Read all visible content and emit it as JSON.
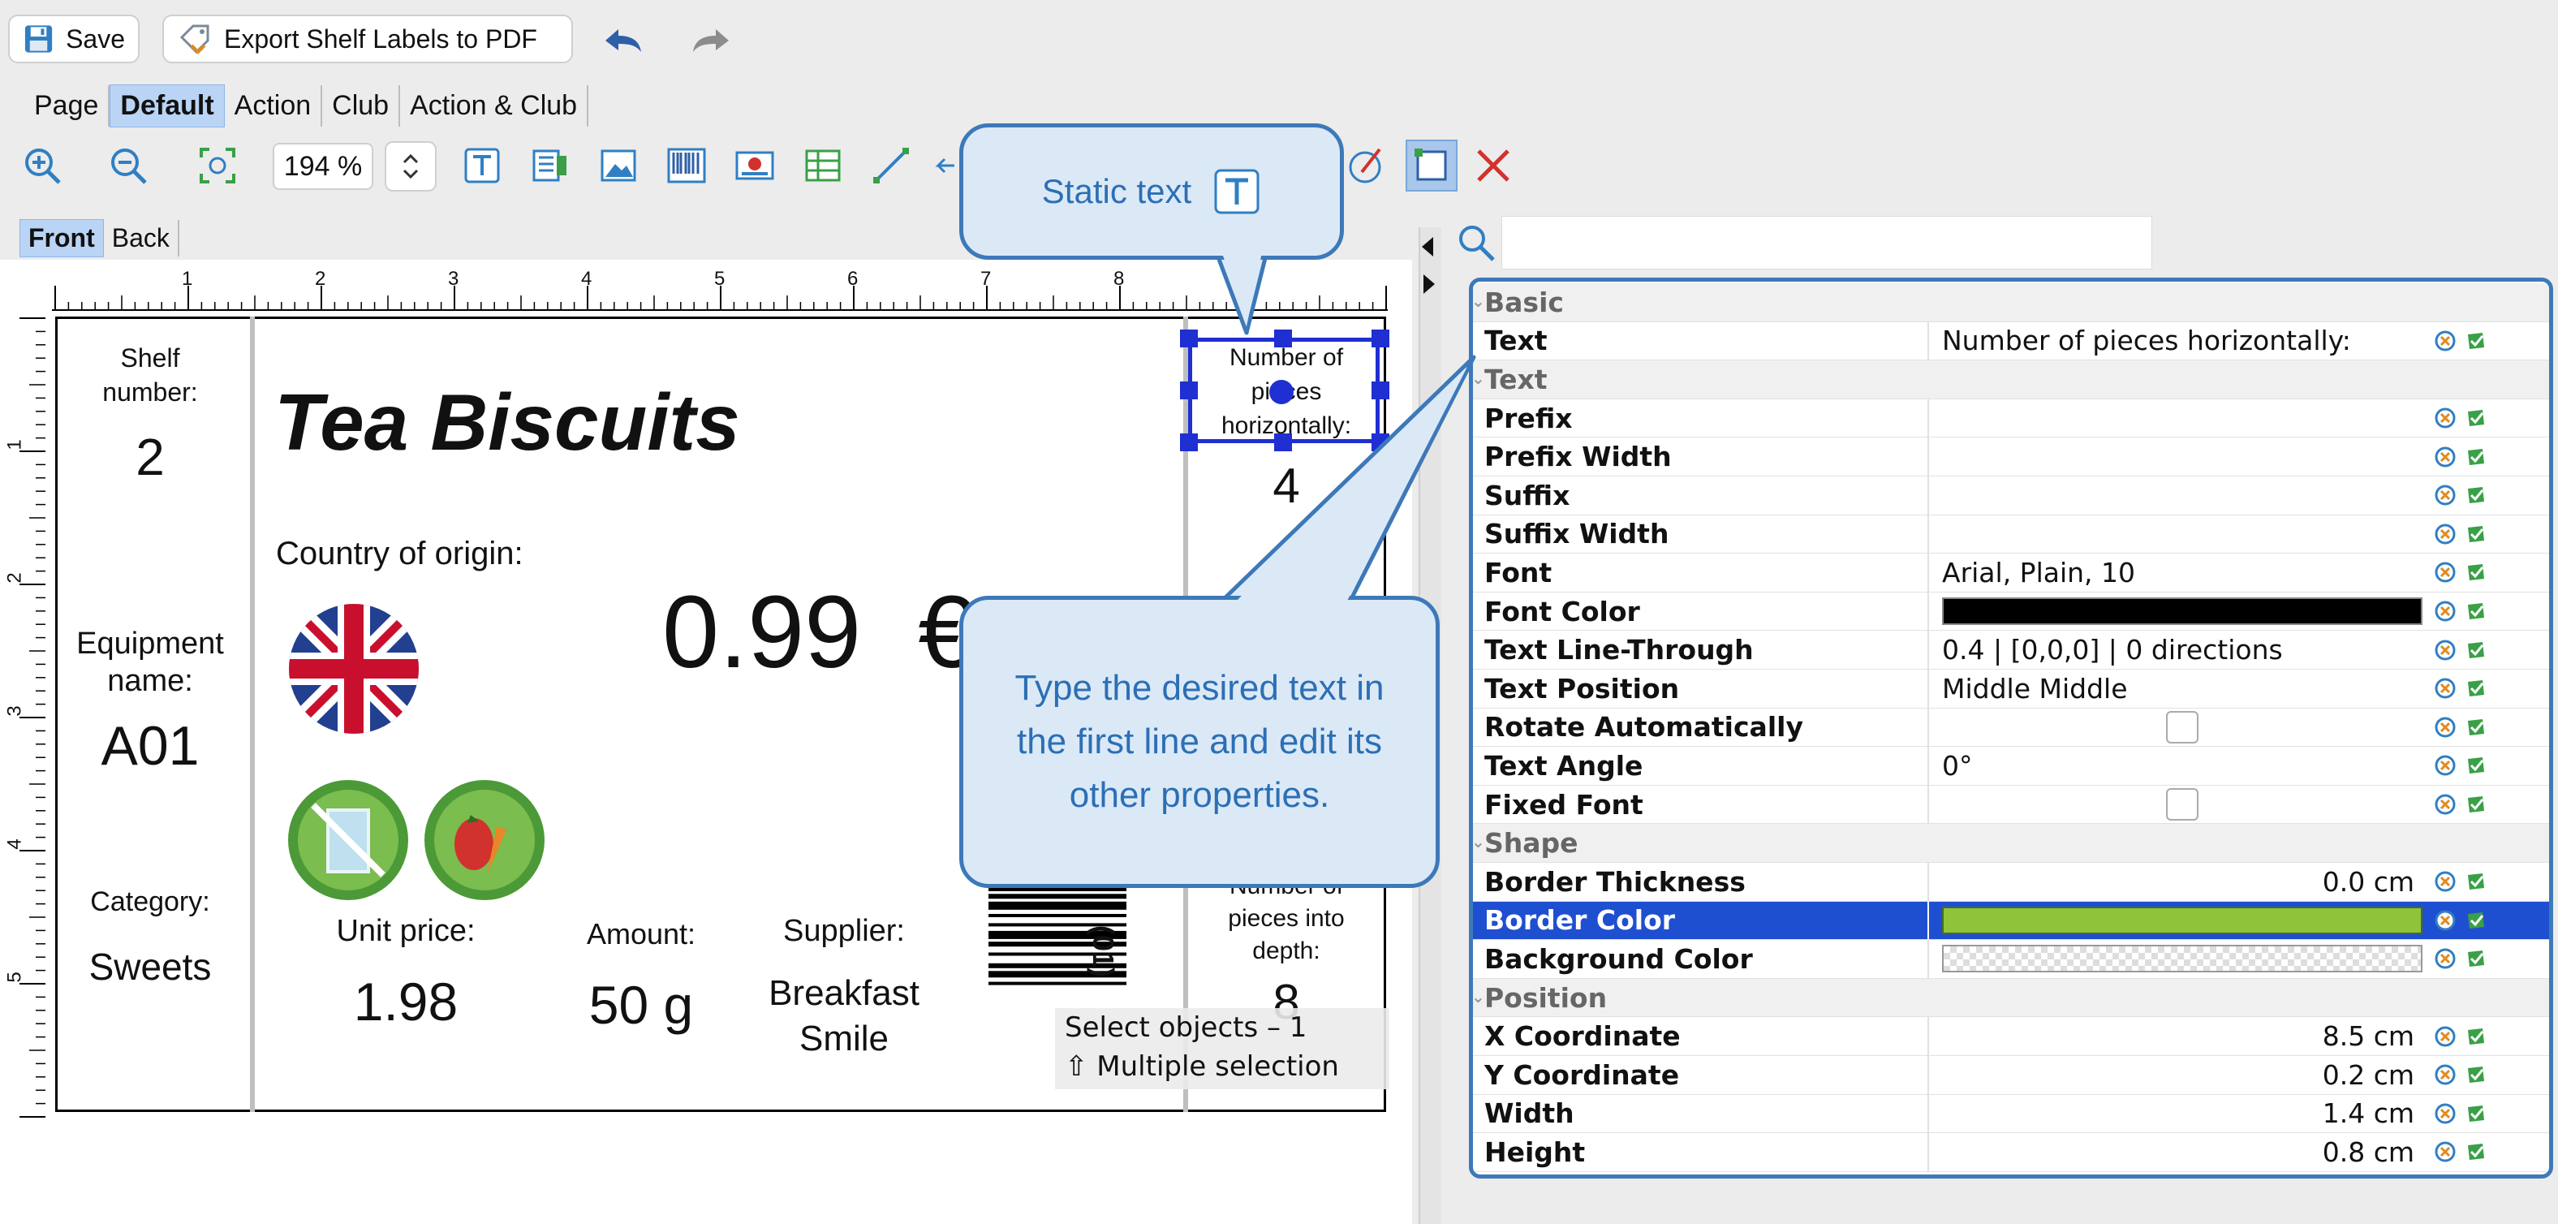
{
  "toolbar": {
    "save_label": "Save",
    "export_label": "Export Shelf Labels to PDF"
  },
  "tabs": [
    "Page",
    "Default",
    "Action",
    "Club",
    "Action & Club"
  ],
  "active_tab": "Default",
  "zoom": {
    "value": "194 %"
  },
  "sides": [
    "Front",
    "Back"
  ],
  "active_side": "Front",
  "ruler_top": [
    "1",
    "2",
    "3",
    "4",
    "5",
    "6",
    "7",
    "8"
  ],
  "ruler_left": [
    "1",
    "2",
    "3",
    "4",
    "5"
  ],
  "label": {
    "shelf_label": "Shelf number:",
    "shelf_value": "2",
    "equipment_label": "Equipment name:",
    "equipment_value": "A01",
    "category_label": "Category:",
    "category_value": "Sweets",
    "product_title": "Tea Biscuits",
    "origin_label": "Country of origin:",
    "price": "0.99  €",
    "unit_price_label": "Unit price:",
    "unit_price_value": "1.98",
    "amount_label": "Amount:",
    "amount_value": "50 g",
    "supplier_label": "Supplier:",
    "supplier_value": "Breakfast Smile",
    "pieces_h_label": "Number of pieces horizontally:",
    "pieces_h_value": "4",
    "pieces_d_label": "Number of pieces into depth:",
    "pieces_d_value": "8",
    "barcode_digits": "(01)"
  },
  "selection_hint": {
    "select_objects": "Select objects – 1",
    "multiple": "⇧ Multiple selection"
  },
  "callouts": {
    "static_text": "Static text",
    "type_text": "Type the desired text in the first line and edit its other properties."
  },
  "properties": {
    "sections": {
      "basic": "Basic",
      "text": "Text",
      "shape": "Shape",
      "position": "Position"
    },
    "rows": {
      "text": {
        "name": "Text",
        "value": "Number of pieces horizontally:"
      },
      "prefix": {
        "name": "Prefix",
        "value": ""
      },
      "prefix_width": {
        "name": "Prefix Width",
        "value": ""
      },
      "suffix": {
        "name": "Suffix",
        "value": ""
      },
      "suffix_width": {
        "name": "Suffix Width",
        "value": ""
      },
      "font": {
        "name": "Font",
        "value": "Arial, Plain, 10"
      },
      "font_color": {
        "name": "Font Color",
        "value": "#000000"
      },
      "line_through": {
        "name": "Text Line-Through",
        "value": "0.4 | [0,0,0] | 0 directions"
      },
      "text_position": {
        "name": "Text Position",
        "value": "Middle Middle"
      },
      "rotate_auto": {
        "name": "Rotate Automatically",
        "value": ""
      },
      "text_angle": {
        "name": "Text Angle",
        "value": "0°"
      },
      "fixed_font": {
        "name": "Fixed Font",
        "value": ""
      },
      "border_thickness": {
        "name": "Border Thickness",
        "value": "0.0 cm"
      },
      "border_color": {
        "name": "Border Color",
        "value": "#8fc43a"
      },
      "background_color": {
        "name": "Background Color",
        "value": ""
      },
      "x_coord": {
        "name": "X Coordinate",
        "value": "8.5 cm"
      },
      "y_coord": {
        "name": "Y Coordinate",
        "value": "0.2 cm"
      },
      "width": {
        "name": "Width",
        "value": "1.4 cm"
      },
      "height": {
        "name": "Height",
        "value": "0.8 cm"
      }
    }
  },
  "colors": {
    "accent": "#3d79b8",
    "selection": "#1f4fd1",
    "border_green": "#8fc43a"
  }
}
